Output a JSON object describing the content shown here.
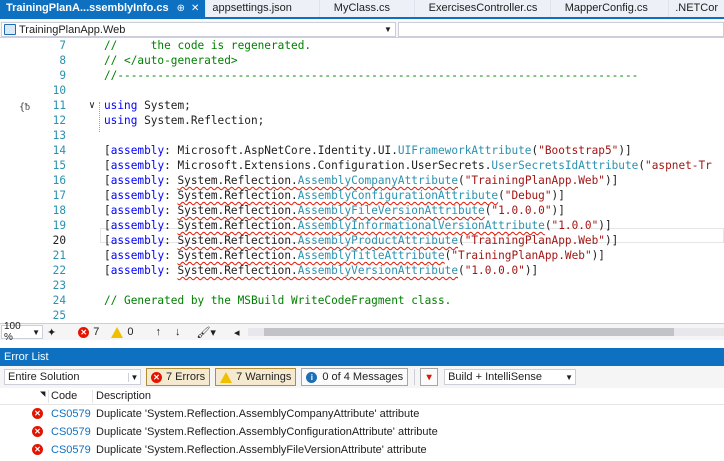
{
  "tabs": [
    {
      "label": "TrainingPlanA...ssemblyInfo.cs",
      "active": true
    },
    {
      "label": "appsettings.json",
      "active": false
    },
    {
      "label": "MyClass.cs",
      "active": false
    },
    {
      "label": "ExercisesController.cs",
      "active": false
    },
    {
      "label": "MapperConfig.cs",
      "active": false
    },
    {
      "label": ".NETCor",
      "active": false
    }
  ],
  "tab_glyphs": {
    "pin": "⊕",
    "close": "✕"
  },
  "navbar": {
    "project": "TrainingPlanApp.Web"
  },
  "editor": {
    "line_numbers": [
      "7",
      "8",
      "9",
      "10",
      "11",
      "12",
      "13",
      "14",
      "15",
      "16",
      "17",
      "18",
      "19",
      "20",
      "21",
      "22",
      "23",
      "24",
      "25"
    ],
    "current_line": "20",
    "lines": {
      "l7": "//     the code is regenerated.",
      "l8": "// </auto-generated>",
      "l9": "//------------------------------------------------------------------------------",
      "l11_kw": "using",
      "l11_ns": " System;",
      "l12_kw": "using",
      "l12_ns": " System.Reflection;",
      "assembly_kw": "assembly",
      "l14_ns": "Microsoft.AspNetCore.Identity.UI.",
      "l14_attr": "UIFrameworkAttribute",
      "l14_str": "\"Bootstrap5\"",
      "l15_ns": "Microsoft.Extensions.Configuration.UserSecrets.",
      "l15_attr": "UserSecretsIdAttribute",
      "l15_str": "\"aspnet-Tr",
      "sysref": "System.Reflection.",
      "l16_attr": "AssemblyCompanyAttribute",
      "l16_str": "\"TrainingPlanApp.Web\"",
      "l17_attr": "AssemblyConfigurationAttribute",
      "l17_str": "\"Debug\"",
      "l18_attr": "AssemblyFileVersionAttribute",
      "l18_str": "\"1.0.0.0\"",
      "l19_attr": "AssemblyInformationalVersionAttribute",
      "l19_str": "\"1.0.0\"",
      "l20_attr": "AssemblyProductAttribute",
      "l20_str": "\"TrainingPlanApp.Web\"",
      "l21_attr": "AssemblyTitleAttribute",
      "l21_str": "\"TrainingPlanApp.Web\"",
      "l22_attr": "AssemblyVersionAttribute",
      "l22_str": "\"1.0.0.0\"",
      "l24": "// Generated by the MSBuild WriteCodeFragment class."
    }
  },
  "status": {
    "zoom": "100 %",
    "errors": "7",
    "warnings": "0"
  },
  "error_list": {
    "title": "Error List",
    "scope": "Entire Solution",
    "errors_btn": "7 Errors",
    "warnings_btn": "7 Warnings",
    "messages_btn": "0 of 4 Messages",
    "build_filter": "Build + IntelliSense",
    "col_code": "Code",
    "col_desc": "Description",
    "rows": [
      {
        "code": "CS0579",
        "desc": "Duplicate 'System.Reflection.AssemblyCompanyAttribute' attribute"
      },
      {
        "code": "CS0579",
        "desc": "Duplicate 'System.Reflection.AssemblyConfigurationAttribute' attribute"
      },
      {
        "code": "CS0579",
        "desc": "Duplicate 'System.Reflection.AssemblyFileVersionAttribute' attribute"
      }
    ]
  },
  "colors": {
    "accent": "#0e70c0",
    "error": "#e51400",
    "warning": "#f0c000",
    "keyword": "#0000ff",
    "comment": "#008000",
    "type": "#2b91af",
    "string": "#a31515"
  }
}
